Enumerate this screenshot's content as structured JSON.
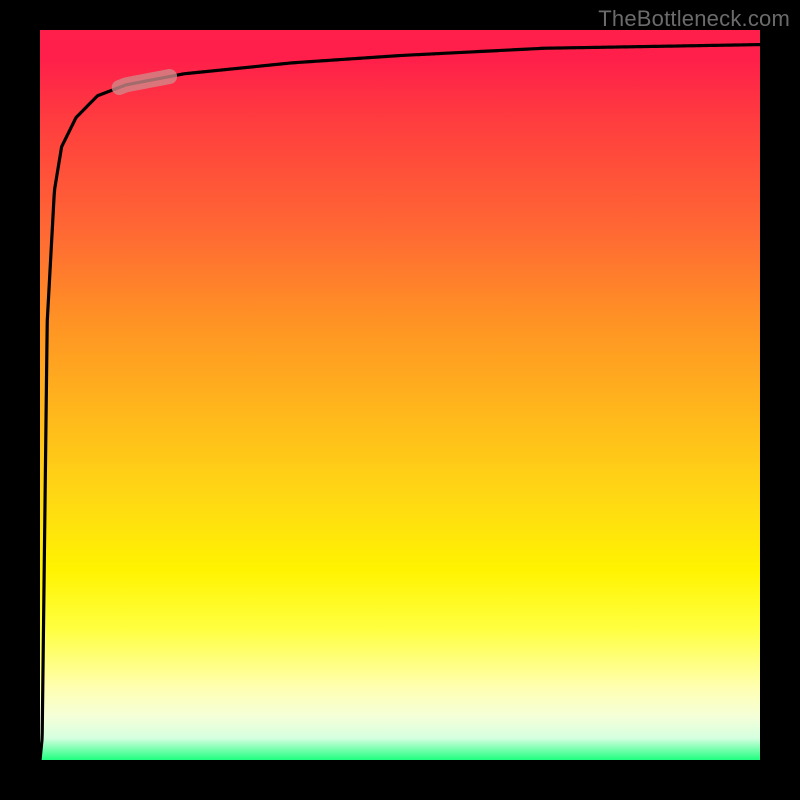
{
  "watermark": "TheBottleneck.com",
  "chart_data": {
    "type": "line",
    "title": "",
    "xlabel": "",
    "ylabel": "",
    "xlim": [
      0,
      100
    ],
    "ylim": [
      0,
      100
    ],
    "grid": false,
    "legend": false,
    "series": [
      {
        "name": "curve",
        "x": [
          0,
          0.3,
          1,
          2,
          3,
          5,
          8,
          12,
          20,
          35,
          50,
          70,
          100
        ],
        "values": [
          0,
          3,
          60,
          78,
          84,
          88,
          91,
          92.5,
          94,
          95.5,
          96.5,
          97.5,
          98
        ]
      }
    ],
    "marker": {
      "x_start": 11,
      "x_end": 18,
      "color": "#d08a8a",
      "opacity": 0.78
    },
    "background_gradient": {
      "top": "#ff1f4a",
      "upper_mid": "#ff9324",
      "mid": "#ffd814",
      "lower_mid": "#ffff40",
      "bottom": "#20ff80"
    }
  }
}
